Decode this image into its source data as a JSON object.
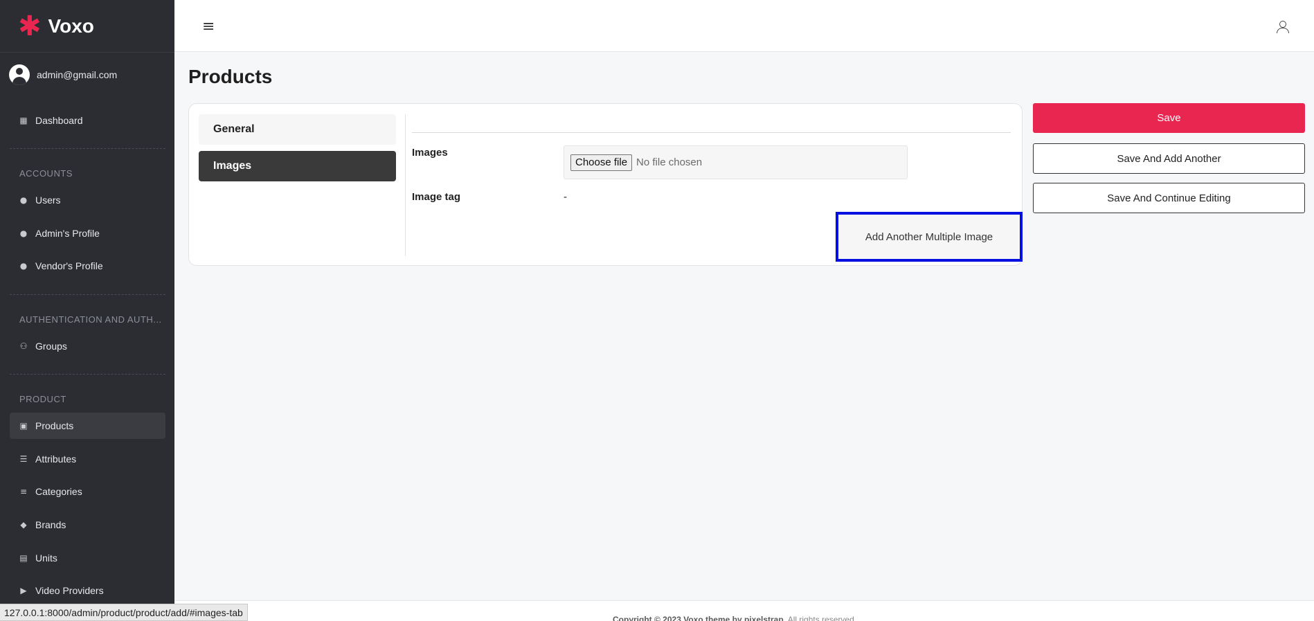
{
  "brand": {
    "name": "Voxo",
    "logo_glyph": "✱",
    "accent": "#e8264f"
  },
  "user": {
    "email": "admin@gmail.com"
  },
  "sidebar": {
    "dashboard": {
      "label": "Dashboard",
      "icon": "grid-icon"
    },
    "sections": [
      {
        "title": "ACCOUNTS"
      },
      {
        "title": "AUTHENTICATION AND AUTH..."
      },
      {
        "title": "PRODUCT"
      }
    ],
    "items": [
      {
        "label": "Users",
        "icon": "user-icon"
      },
      {
        "label": "Admin's Profile",
        "icon": "user-icon"
      },
      {
        "label": "Vendor's Profile",
        "icon": "user-icon"
      },
      {
        "label": "Groups",
        "icon": "users-icon"
      },
      {
        "label": "Products",
        "icon": "box-icon",
        "active": true
      },
      {
        "label": "Attributes",
        "icon": "list-icon"
      },
      {
        "label": "Categories",
        "icon": "align-icon"
      },
      {
        "label": "Brands",
        "icon": "gem-icon"
      },
      {
        "label": "Units",
        "icon": "archive-icon"
      },
      {
        "label": "Video Providers",
        "icon": "video-icon"
      }
    ]
  },
  "topbar": {
    "menu_icon": "hamburger-icon",
    "profile_icon": "user-outline-icon"
  },
  "page": {
    "title": "Products"
  },
  "tabs": [
    {
      "label": "General",
      "active": false
    },
    {
      "label": "Images",
      "active": true
    }
  ],
  "form": {
    "images_label": "Images",
    "file_button": "Choose file",
    "file_status": "No file chosen",
    "image_tag_label": "Image tag",
    "image_tag_value": "-",
    "add_another_label": "Add Another Multiple Image"
  },
  "actions": {
    "save": "Save",
    "save_add_another": "Save And Add Another",
    "save_continue": "Save And Continue Editing"
  },
  "footer": {
    "text_bold": "Copyright © 2023 Voxo theme by pixelstrap.",
    "text_rest": " All rights reserved."
  },
  "statusbar": {
    "url": "127.0.0.1:8000/admin/product/product/add/#images-tab"
  }
}
